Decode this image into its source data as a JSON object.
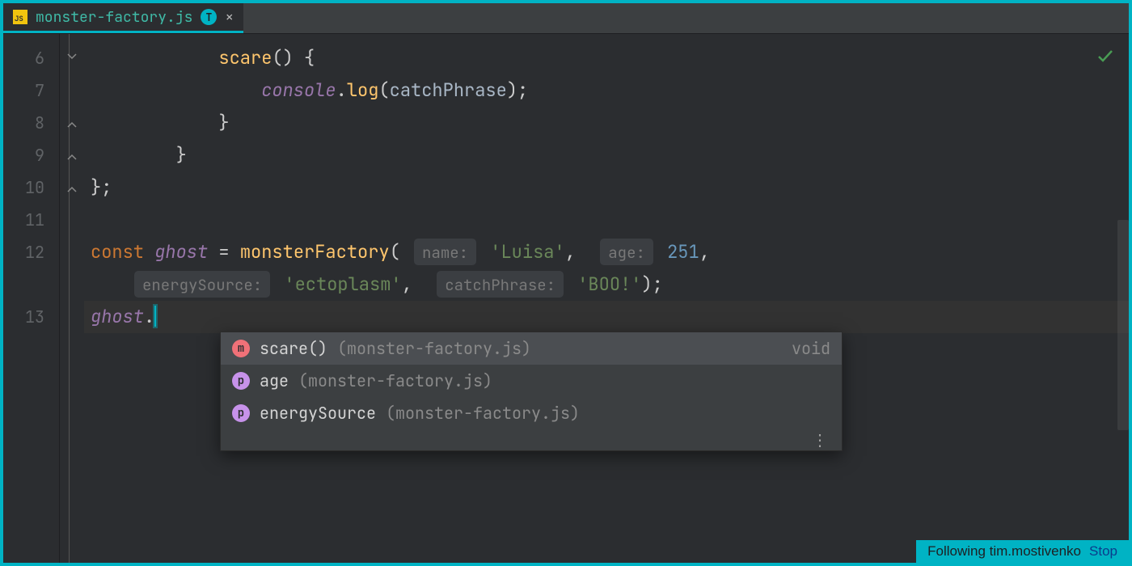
{
  "tab": {
    "filename": "monster-factory.js",
    "badge": "T",
    "js_label": "JS"
  },
  "gutter": {
    "lines": [
      "6",
      "7",
      "8",
      "9",
      "10",
      "11",
      "12",
      "",
      "13"
    ]
  },
  "code": {
    "l6": {
      "indent": "            ",
      "fn": "scare",
      "paren": "() {"
    },
    "l7": {
      "indent": "                ",
      "obj": "console",
      "dot": ".",
      "fn": "log",
      "open": "(",
      "arg": "catchPhrase",
      "close": ");"
    },
    "l8": {
      "indent": "            ",
      "brace": "}"
    },
    "l9": {
      "indent": "        ",
      "brace": "}"
    },
    "l10": {
      "brace": "};"
    },
    "l12a": {
      "kw": "const ",
      "id": "ghost",
      "eq": " = ",
      "fn": "monsterFactory",
      "open": "(",
      "h1": "name:",
      "s1": "'Luisa'",
      "c1": ",",
      "h2": "age:",
      "n1": "251",
      "c2": ","
    },
    "l12b": {
      "h3": "energySource:",
      "s3": "'ectoplasm'",
      "c3": ",",
      "h4": "catchPhrase:",
      "s4": "'BOO!'",
      "close": ");"
    },
    "l13": {
      "id": "ghost",
      "dot": "."
    }
  },
  "popup": {
    "items": [
      {
        "icon": "m",
        "icon_class": "ic-m",
        "name": "scare()",
        "loc": "(monster-factory.js)",
        "ret": "void",
        "selected": true
      },
      {
        "icon": "p",
        "icon_class": "ic-p",
        "name": "age",
        "loc": "(monster-factory.js)",
        "ret": "",
        "selected": false
      },
      {
        "icon": "p",
        "icon_class": "ic-p",
        "name": "energySource",
        "loc": "(monster-factory.js)",
        "ret": "",
        "selected": false
      }
    ],
    "more": "⋮"
  },
  "status": {
    "text": "Following tim.mostivenko",
    "stop": "Stop"
  }
}
